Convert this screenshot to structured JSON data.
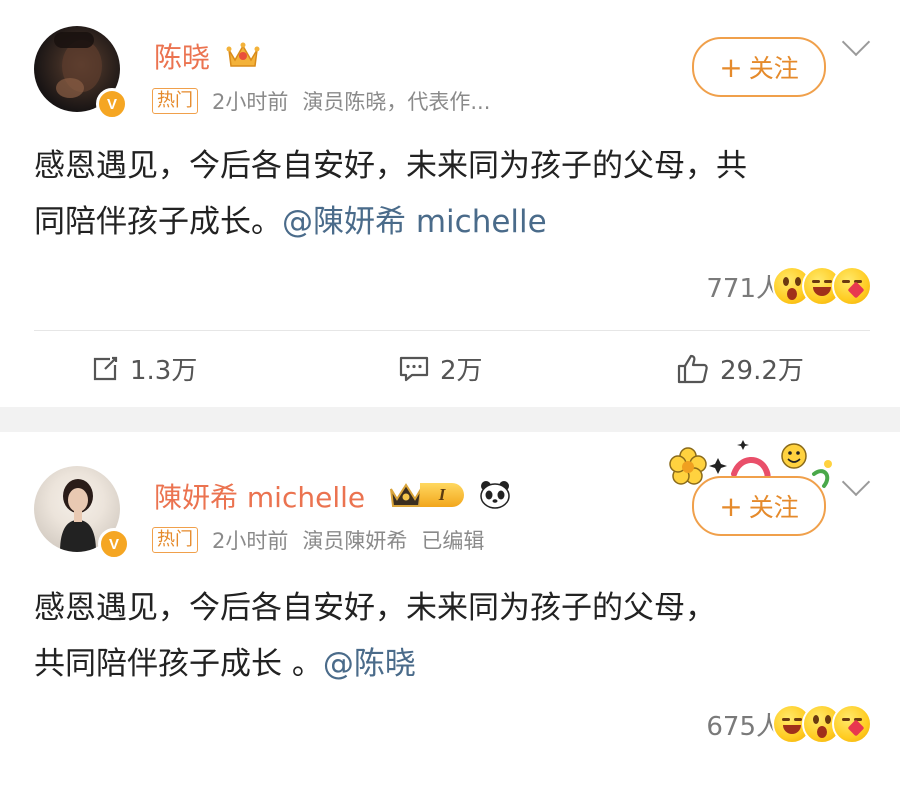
{
  "posts": [
    {
      "username": "陈晓",
      "hot_tag": "热门",
      "time": "2小时前",
      "source": "演员陈晓，代表作...",
      "follow_label": "关注",
      "content_line1": "感恩遇见，今后各自安好，未来同为孩子的父母，共",
      "content_line2_text": "同陪伴孩子成长。",
      "mention": "@陳妍希 michelle",
      "reaction_count": "771人",
      "actions": {
        "repost": "1.3万",
        "comment": "2万",
        "like": "29.2万"
      },
      "icons": [
        "crown-icon",
        "verified-icon",
        "chevron-down-icon",
        "repost-icon",
        "comment-icon",
        "like-icon"
      ]
    },
    {
      "username": "陳妍希 michelle",
      "hot_tag": "热门",
      "time": "2小时前",
      "source": "演员陳妍希",
      "edited": "已编辑",
      "follow_label": "关注",
      "content_line1": "感恩遇见，今后各自安好，未来同为孩子的父母，",
      "content_line2_text": "共同陪伴孩子成长 。",
      "mention": "@陈晓",
      "reaction_count": "675人",
      "member_level": "I",
      "icons": [
        "member-crown-icon",
        "panda-icon",
        "verified-icon",
        "chevron-down-icon",
        "flower-sticker"
      ]
    }
  ],
  "colors": {
    "username": "#eb7350",
    "mention": "#4a6b8a",
    "accent": "#f0a04b",
    "divider": "#f2f2f2"
  }
}
